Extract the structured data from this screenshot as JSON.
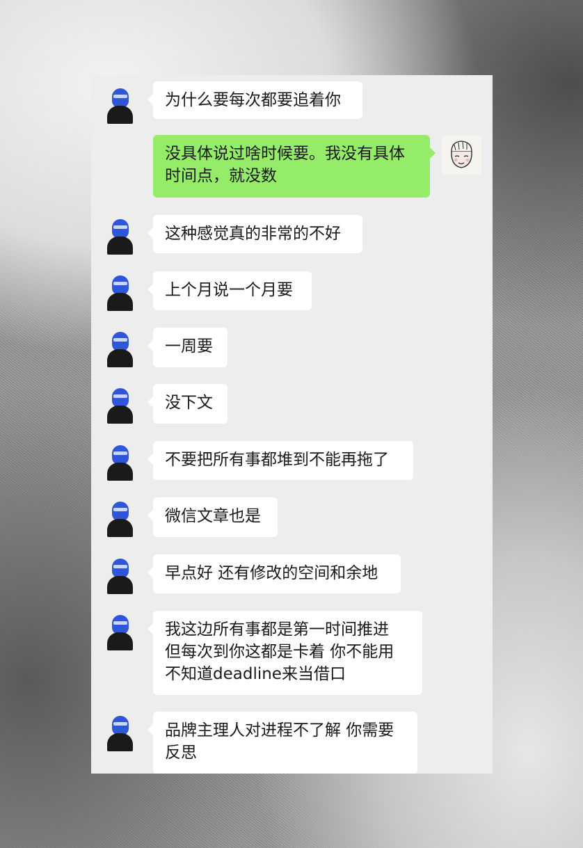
{
  "chat": {
    "messages": [
      {
        "side": "left",
        "lines": [
          "为什么要每次都要追着你"
        ]
      },
      {
        "side": "right",
        "lines": [
          "没具体说过啥时候要。我没有具体",
          "时间点，就没数"
        ]
      },
      {
        "side": "left",
        "lines": [
          "这种感觉真的非常的不好"
        ]
      },
      {
        "side": "left",
        "lines": [
          "上个月说一个月要"
        ]
      },
      {
        "side": "left",
        "lines": [
          "一周要"
        ]
      },
      {
        "side": "left",
        "lines": [
          "没下文"
        ]
      },
      {
        "side": "left",
        "lines": [
          "不要把所有事都堆到不能再拖了"
        ]
      },
      {
        "side": "left",
        "lines": [
          "微信文章也是"
        ]
      },
      {
        "side": "left",
        "lines": [
          "早点好 还有修改的空间和余地"
        ]
      },
      {
        "side": "left",
        "lines": [
          "我这边所有事都是第一时间推进",
          "但每次到你这都是卡着 你不能用",
          "不知道deadline来当借口"
        ]
      },
      {
        "side": "left",
        "lines": [
          "品牌主理人对进程不了解 你需要",
          "反思"
        ]
      }
    ],
    "colors": {
      "background": "#ededed",
      "incoming_bubble": "#ffffff",
      "outgoing_bubble": "#95ec69",
      "text": "#191919"
    },
    "icons": {
      "contact_avatar": "blue-masked-person-avatar-icon",
      "self_avatar": "hand-drawn-face-avatar-icon"
    }
  }
}
